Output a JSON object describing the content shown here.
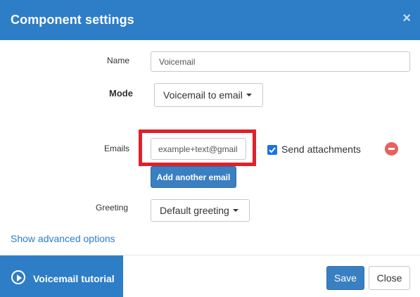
{
  "dialog": {
    "title": "Component settings",
    "close_glyph": "×"
  },
  "form": {
    "name_label": "Name",
    "name_value": "Voicemail",
    "mode_label": "Mode",
    "mode_value": "Voicemail to email",
    "emails_label": "Emails",
    "email_value": "example+text@gmail",
    "send_attachments_label": "Send attachments",
    "send_attachments_checked": true,
    "add_email_label": "Add another email",
    "greeting_label": "Greeting",
    "greeting_value": "Default greeting",
    "advanced_link": "Show advanced options"
  },
  "footer": {
    "tutorial_label": "Voicemail tutorial",
    "save_label": "Save",
    "close_label": "Close"
  },
  "icons": {
    "close": "close-icon",
    "remove": "remove-circle-icon",
    "play": "play-circle-icon",
    "check": "checkmark-icon",
    "caret": "caret-down-icon"
  },
  "colors": {
    "header_blue": "#2e7dc7",
    "button_blue": "#3a7fc1",
    "highlight_red": "#e0202a",
    "remove_red": "#e8605d",
    "checkbox_blue": "#1a73e8"
  }
}
